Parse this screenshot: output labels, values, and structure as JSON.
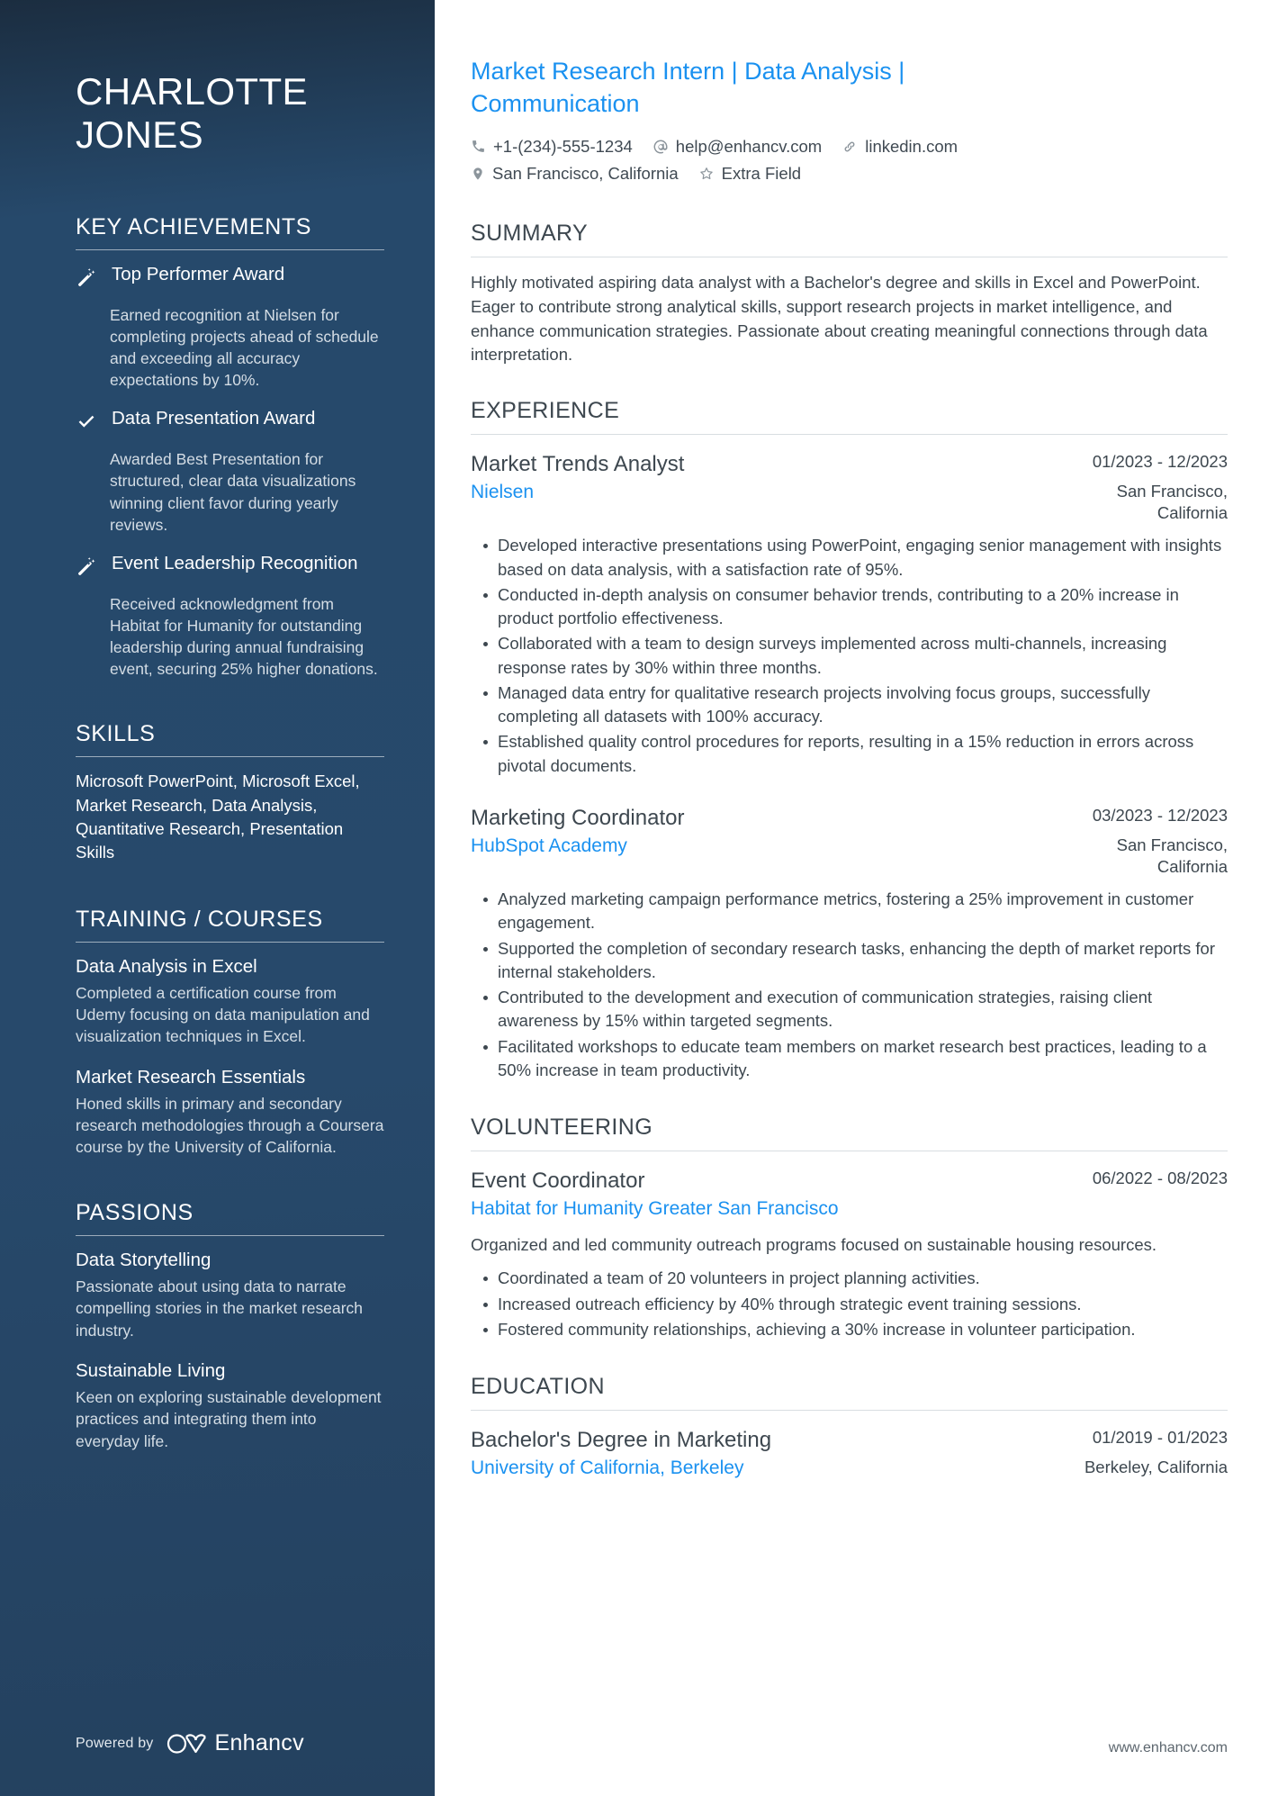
{
  "sidebar": {
    "name": "CHARLOTTE JONES",
    "sections": {
      "achievements": {
        "heading": "KEY ACHIEVEMENTS",
        "items": [
          {
            "icon": "magic-wand-icon",
            "title": "Top Performer Award",
            "description": "Earned recognition at Nielsen for completing projects ahead of schedule and exceeding all accuracy expectations by 10%."
          },
          {
            "icon": "check-icon",
            "title": "Data Presentation Award",
            "description": "Awarded Best Presentation for structured, clear data visualizations winning client favor during yearly reviews."
          },
          {
            "icon": "magic-wand-icon",
            "title": "Event Leadership Recognition",
            "description": "Received acknowledgment from Habitat for Humanity for outstanding leadership during annual fundraising event, securing 25% higher donations."
          }
        ]
      },
      "skills": {
        "heading": "SKILLS",
        "text": "Microsoft PowerPoint, Microsoft Excel, Market Research, Data Analysis, Quantitative Research, Presentation Skills"
      },
      "training": {
        "heading": "TRAINING / COURSES",
        "items": [
          {
            "title": "Data Analysis in Excel",
            "description": "Completed a certification course from Udemy focusing on data manipulation and visualization techniques in Excel."
          },
          {
            "title": "Market Research Essentials",
            "description": "Honed skills in primary and secondary research methodologies through a Coursera course by the University of California."
          }
        ]
      },
      "passions": {
        "heading": "PASSIONS",
        "items": [
          {
            "title": "Data Storytelling",
            "description": "Passionate about using data to narrate compelling stories in the market research industry."
          },
          {
            "title": "Sustainable Living",
            "description": "Keen on exploring sustainable development practices and integrating them into everyday life."
          }
        ]
      }
    },
    "footer": {
      "powered_by": "Powered by",
      "brand": "Enhancv"
    }
  },
  "main": {
    "headline": "Market Research Intern | Data Analysis | Communication",
    "contacts": [
      {
        "icon": "phone-icon",
        "value": "+1-(234)-555-1234"
      },
      {
        "icon": "at-sign-icon",
        "value": "help@enhancv.com"
      },
      {
        "icon": "link-icon",
        "value": "linkedin.com"
      },
      {
        "icon": "location-pin-icon",
        "value": "San Francisco, California"
      },
      {
        "icon": "star-icon",
        "value": "Extra Field"
      }
    ],
    "summary": {
      "heading": "SUMMARY",
      "text": "Highly motivated aspiring data analyst with a Bachelor's degree and skills in Excel and PowerPoint. Eager to contribute strong analytical skills, support research projects in market intelligence, and enhance communication strategies. Passionate about creating meaningful connections through data interpretation."
    },
    "experience": {
      "heading": "EXPERIENCE",
      "entries": [
        {
          "title": "Market Trends Analyst",
          "organization": "Nielsen",
          "date": "01/2023 - 12/2023",
          "location": "San Francisco, California",
          "bullets": [
            "Developed interactive presentations using PowerPoint, engaging senior management with insights based on data analysis, with a satisfaction rate of 95%.",
            "Conducted in-depth analysis on consumer behavior trends, contributing to a 20% increase in product portfolio effectiveness.",
            "Collaborated with a team to design surveys implemented across multi-channels, increasing response rates by 30% within three months.",
            "Managed data entry for qualitative research projects involving focus groups, successfully completing all datasets with 100% accuracy.",
            "Established quality control procedures for reports, resulting in a 15% reduction in errors across pivotal documents."
          ]
        },
        {
          "title": "Marketing Coordinator",
          "organization": "HubSpot Academy",
          "date": "03/2023 - 12/2023",
          "location": "San Francisco, California",
          "bullets": [
            "Analyzed marketing campaign performance metrics, fostering a 25% improvement in customer engagement.",
            "Supported the completion of secondary research tasks, enhancing the depth of market reports for internal stakeholders.",
            "Contributed to the development and execution of communication strategies, raising client awareness by 15% within targeted segments.",
            "Facilitated workshops to educate team members on market research best practices, leading to a 50% increase in team productivity."
          ]
        }
      ]
    },
    "volunteering": {
      "heading": "VOLUNTEERING",
      "entries": [
        {
          "title": "Event Coordinator",
          "organization": "Habitat for Humanity Greater San Francisco",
          "date": "06/2022 - 08/2023",
          "location": "",
          "intro": "Organized and led community outreach programs focused on sustainable housing resources.",
          "bullets": [
            "Coordinated a team of 20 volunteers in project planning activities.",
            "Increased outreach efficiency by 40% through strategic event training sessions.",
            "Fostered community relationships, achieving a 30% increase in volunteer participation."
          ]
        }
      ]
    },
    "education": {
      "heading": "EDUCATION",
      "entries": [
        {
          "title": "Bachelor's Degree in Marketing",
          "organization": "University of California, Berkeley",
          "date": "01/2019 - 01/2023",
          "location": "Berkeley, California"
        }
      ]
    },
    "footer": {
      "site": "www.enhancv.com"
    }
  },
  "colors": {
    "sidebar_bg": "#27496b",
    "accent_blue": "#1a91f0",
    "body_text": "#3d474f",
    "muted_text": "#d4dde5"
  }
}
